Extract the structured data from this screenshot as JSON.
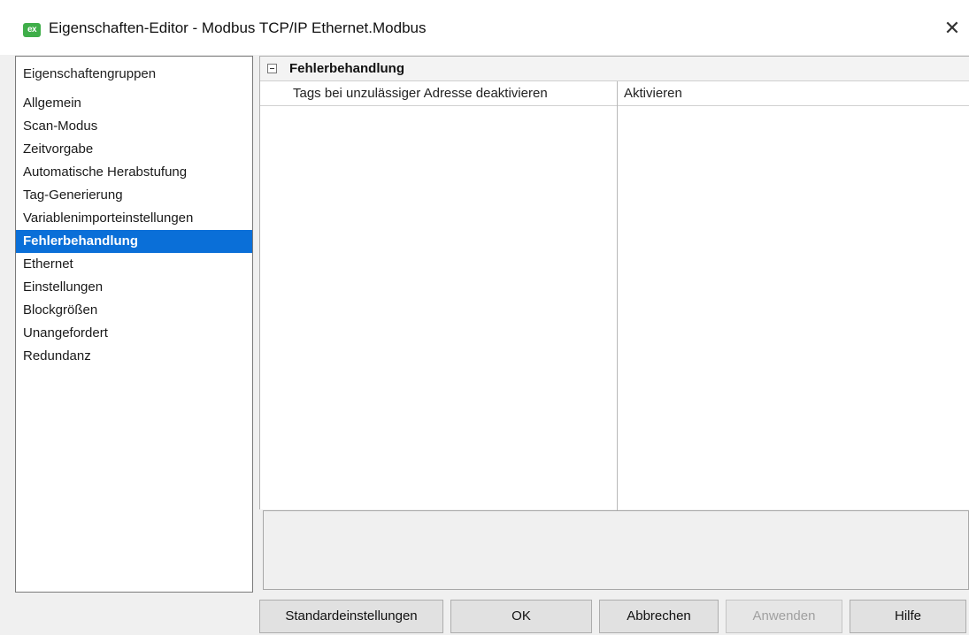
{
  "window": {
    "app_icon_text": "ex",
    "title": "Eigenschaften-Editor - Modbus TCP/IP Ethernet.Modbus",
    "close_glyph": "✕"
  },
  "groups": {
    "header": "Eigenschaftengruppen",
    "items": [
      {
        "label": "Allgemein"
      },
      {
        "label": "Scan-Modus"
      },
      {
        "label": "Zeitvorgabe"
      },
      {
        "label": "Automatische Herabstufung"
      },
      {
        "label": "Tag-Generierung"
      },
      {
        "label": "Variablenimporteinstellungen"
      },
      {
        "label": "Fehlerbehandlung",
        "selected": true
      },
      {
        "label": "Ethernet"
      },
      {
        "label": "Einstellungen"
      },
      {
        "label": "Blockgrößen"
      },
      {
        "label": "Unangefordert"
      },
      {
        "label": "Redundanz"
      }
    ]
  },
  "property_grid": {
    "category": "Fehlerbehandlung",
    "rows": [
      {
        "name": "Tags bei unzulässiger Adresse deaktivieren",
        "value": "Aktivieren"
      }
    ]
  },
  "buttons": {
    "defaults": "Standardeinstellungen",
    "ok": "OK",
    "cancel": "Abbrechen",
    "apply": "Anwenden",
    "help": "Hilfe"
  },
  "colors": {
    "selection": "#0a6fd8",
    "app_icon": "#3fae49"
  }
}
